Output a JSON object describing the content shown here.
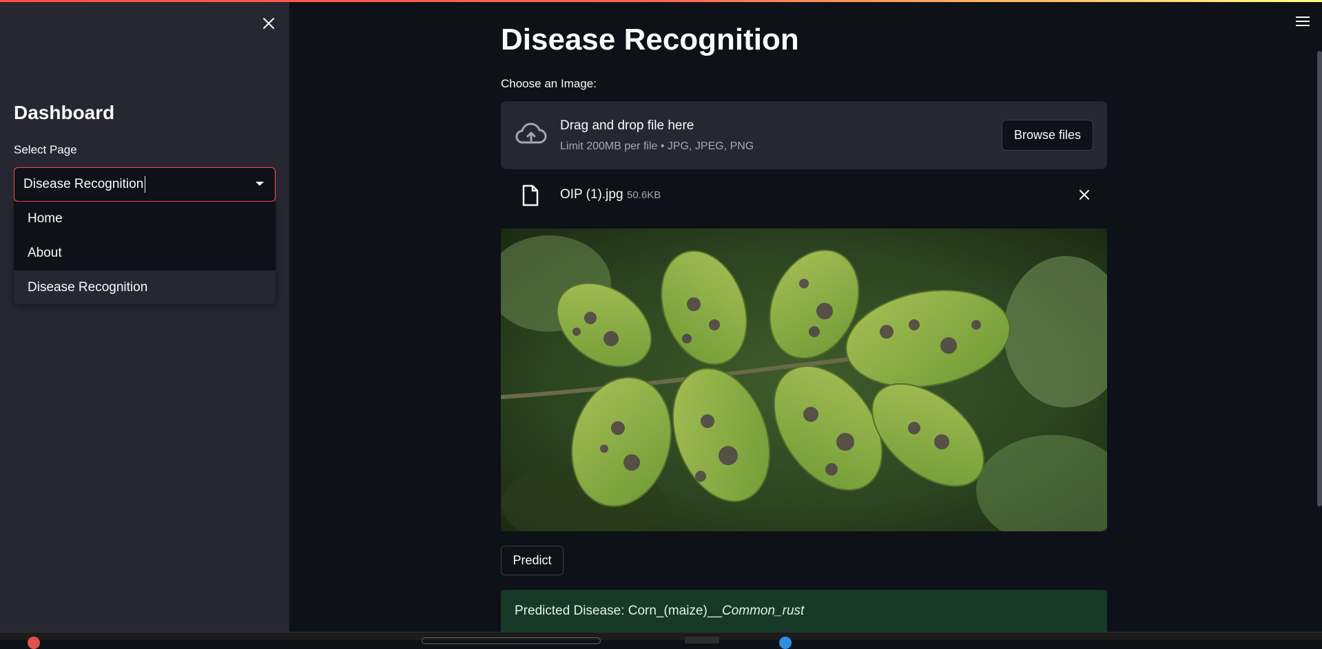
{
  "sidebar": {
    "title": "Dashboard",
    "select_label": "Select Page",
    "selected_value": "Disease Recognition",
    "options": [
      "Home",
      "About",
      "Disease Recognition"
    ]
  },
  "main": {
    "title": "Disease Recognition",
    "uploader": {
      "label": "Choose an Image:",
      "drop_text": "Drag and drop file here",
      "limit_text": "Limit 200MB per file • JPG, JPEG, PNG",
      "browse_label": "Browse files"
    },
    "file": {
      "name": "OIP (1).jpg",
      "size": "50.6KB"
    },
    "predict_label": "Predict",
    "result": {
      "prefix": "Predicted Disease: Corn_(maize)__",
      "disease": "Common_rust"
    }
  },
  "colors": {
    "background": "#0e1117",
    "sidebar": "#262730",
    "accent": "#ff4b4b",
    "success_bg": "#173928"
  },
  "icons": [
    "close-icon",
    "hamburger-menu-icon",
    "cloud-upload-icon",
    "file-icon",
    "remove-file-icon",
    "dropdown-arrow-icon"
  ]
}
